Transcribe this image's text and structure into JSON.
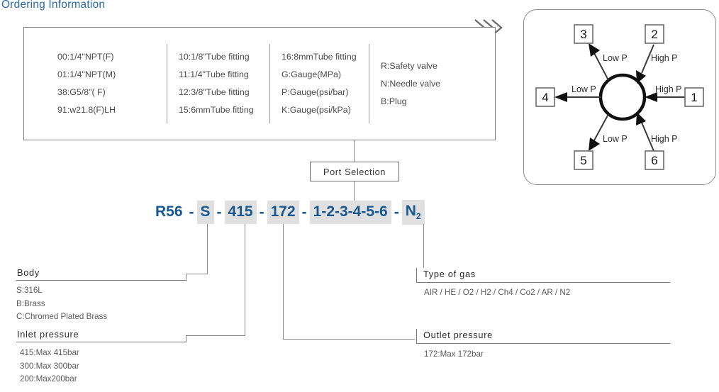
{
  "title": "Ordering Information",
  "accent_color": "#2a6aa6",
  "part_number_color": "#18588f",
  "highlight_color": "#e0e0e0",
  "options_table": {
    "columns": [
      {
        "name": "port-codes-threaded",
        "rows": [
          "00:1/4\"NPT(F)",
          "01:1/4\"NPT(M)",
          "38:G5/8\"( F)",
          "91:w21.8(F)LH"
        ]
      },
      {
        "name": "port-codes-tube",
        "rows": [
          "10:1/8\"Tube fitting",
          "11:1/4\"Tube fitting",
          "12:3/8\"Tube fitting",
          "15:6mmTube fitting"
        ]
      },
      {
        "name": "port-codes-gauge",
        "rows": [
          "16:8mmTube fitting",
          "G:Gauge(MPa)",
          "P:Gauge(psi/bar)",
          "K:Gauge(psi/kPa)"
        ]
      },
      {
        "name": "port-codes-accessory",
        "rows": [
          "R:Safety valve",
          "N:Needle valve",
          "B:Plug"
        ]
      }
    ]
  },
  "port_selection_label": "Port Selection",
  "part_number": {
    "segments": [
      {
        "text": "R56",
        "highlight": false
      },
      {
        "text": "S",
        "highlight": true
      },
      {
        "text": "415",
        "highlight": true
      },
      {
        "text": "172",
        "highlight": true
      },
      {
        "text": "1-2-3-4-5-6",
        "highlight": true
      },
      {
        "text": "N",
        "subscript": "2",
        "highlight": true
      }
    ],
    "separator": "-"
  },
  "labels": {
    "body": {
      "heading": "Body",
      "items": [
        "S:316L",
        "B:Brass",
        "C:Chromed Plated Brass"
      ]
    },
    "inlet_pressure": {
      "heading": "Inlet pressure",
      "items": [
        "415:Max 415bar",
        "300:Max 300bar",
        "200:Max200bar"
      ]
    },
    "type_of_gas": {
      "heading": "Type of gas",
      "items": [
        "AIR / HE / O2  / H2  / Ch4 / Co2  / AR / N2"
      ]
    },
    "outlet_pressure": {
      "heading": "Outlet pressure",
      "items": [
        "172:Max 172bar"
      ]
    }
  },
  "valve_diagram": {
    "ports": [
      {
        "number": "1",
        "pressure": "High P",
        "position": "right"
      },
      {
        "number": "2",
        "pressure": "High P",
        "position": "top-right"
      },
      {
        "number": "3",
        "pressure": "Low P",
        "position": "top-left"
      },
      {
        "number": "4",
        "pressure": "Low P",
        "position": "left"
      },
      {
        "number": "5",
        "pressure": "Low P",
        "position": "bottom-left"
      },
      {
        "number": "6",
        "pressure": "High P",
        "position": "bottom-right"
      }
    ]
  }
}
